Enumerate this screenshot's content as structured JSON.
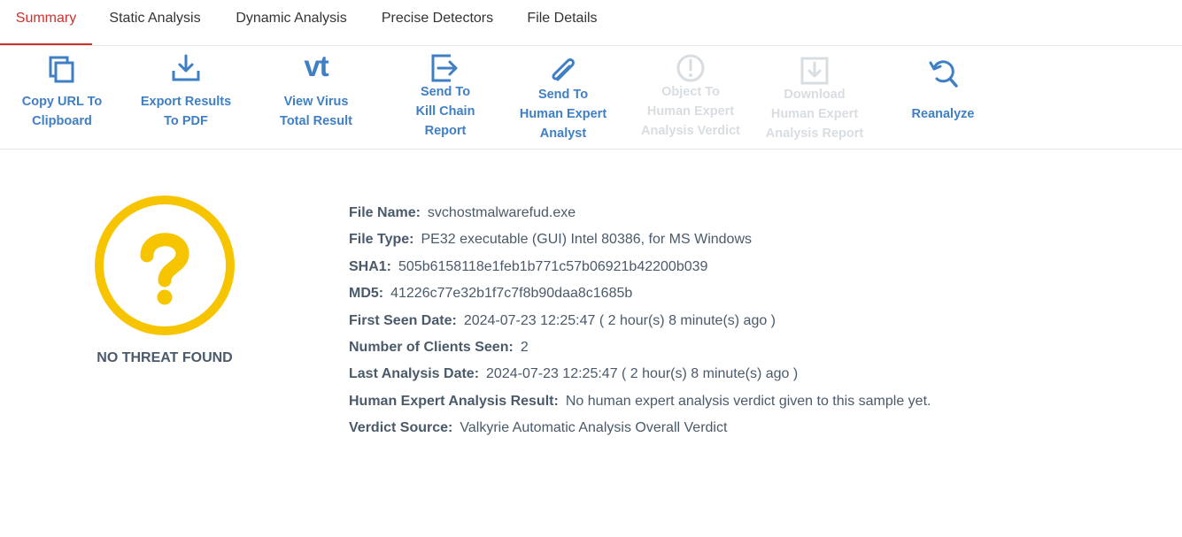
{
  "tabs": [
    {
      "label": "Summary",
      "active": true
    },
    {
      "label": "Static Analysis",
      "active": false
    },
    {
      "label": "Dynamic Analysis",
      "active": false
    },
    {
      "label": "Precise Detectors",
      "active": false
    },
    {
      "label": "File Details",
      "active": false
    }
  ],
  "toolbar": {
    "copy_url": {
      "line1": "Copy URL To",
      "line2": "Clipboard",
      "icon": "copy-icon"
    },
    "export_pdf": {
      "line1": "Export Results",
      "line2": "To PDF",
      "icon": "download-icon"
    },
    "virustotal": {
      "line1": "View Virus",
      "line2": "Total Result",
      "icon": "virustotal-icon",
      "icon_text": "vt"
    },
    "kill_chain": {
      "line1": "Send To",
      "line2": "Kill Chain",
      "line3": "Report",
      "icon": "send-arrow-icon"
    },
    "human_expert": {
      "line1": "Send To",
      "line2": "Human Expert",
      "line3": "Analyst",
      "icon": "paperclip-icon"
    },
    "object_verdict": {
      "line1": "Object To",
      "line2": "Human Expert",
      "line3": "Analysis Verdict",
      "icon": "alert-circle-icon",
      "disabled": true
    },
    "download_report": {
      "line1": "Download",
      "line2": "Human Expert",
      "line3": "Analysis Report",
      "icon": "download-box-icon",
      "disabled": true
    },
    "reanalyze": {
      "line1": "Reanalyze",
      "icon": "reanalyze-icon"
    }
  },
  "colors": {
    "accent": "#d0312d",
    "toolbar_blue": "#3f7fc4",
    "disabled": "#d8dde2",
    "verdict_yellow": "#f7c500",
    "text": "#4a5a6a"
  },
  "summary": {
    "verdict_label": "NO THREAT FOUND",
    "verdict_icon": "question-circle-icon",
    "details": [
      {
        "key": "File Name:",
        "value": "svchostmalwarefud.exe"
      },
      {
        "key": "File Type:",
        "value": "PE32 executable (GUI) Intel 80386, for MS Windows"
      },
      {
        "key": "SHA1:",
        "value": "505b6158118e1feb1b771c57b06921b42200b039"
      },
      {
        "key": "MD5:",
        "value": "41226c77e32b1f7c7f8b90daa8c1685b"
      },
      {
        "key": "First Seen Date:",
        "value": "2024-07-23 12:25:47 ( 2 hour(s) 8 minute(s) ago )"
      },
      {
        "key": "Number of Clients Seen:",
        "value": "2"
      },
      {
        "key": "Last Analysis Date:",
        "value": "2024-07-23 12:25:47 ( 2 hour(s) 8 minute(s) ago )"
      },
      {
        "key": "Human Expert Analysis Result:",
        "value": "No human expert analysis verdict given to this sample yet."
      },
      {
        "key": "Verdict Source:",
        "value": "Valkyrie Automatic Analysis Overall Verdict"
      }
    ]
  }
}
